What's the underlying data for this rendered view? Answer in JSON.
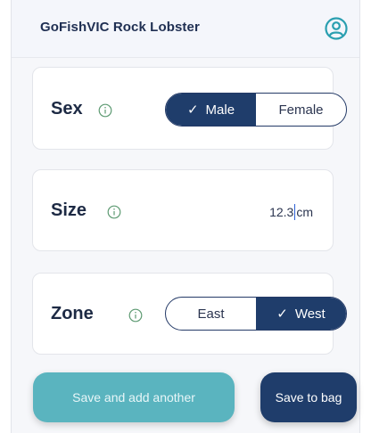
{
  "header": {
    "title": "GoFishVIC Rock Lobster",
    "profile_icon": "user-circle-icon"
  },
  "colors": {
    "navy": "#1f3d6b",
    "teal": "#5ab4bf",
    "profile_teal": "#2a9fb0"
  },
  "sex": {
    "label": "Sex",
    "options": [
      "Male",
      "Female"
    ],
    "selected": "Male",
    "check_glyph": "✓"
  },
  "size": {
    "label": "Size",
    "value_before_caret": "12.3",
    "unit": "cm"
  },
  "zone": {
    "label": "Zone",
    "options": [
      "East",
      "West"
    ],
    "selected": "West",
    "check_glyph": "✓"
  },
  "actions": {
    "save_add_another": "Save and add another",
    "save_to_bag": "Save to bag"
  }
}
